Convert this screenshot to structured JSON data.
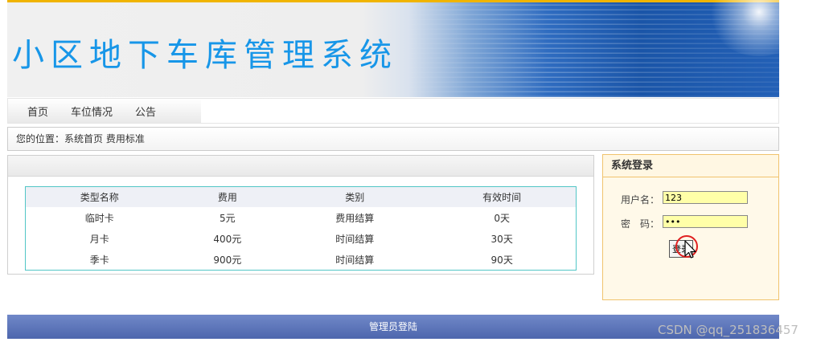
{
  "banner": {
    "title": "小区地下车库管理系统"
  },
  "nav": {
    "items": [
      "首页",
      "车位情况",
      "公告"
    ]
  },
  "breadcrumb": {
    "label": "您的位置：",
    "path": "系统首页 费用标准"
  },
  "fee_table": {
    "headers": [
      "类型名称",
      "费用",
      "类别",
      "有效时间"
    ],
    "rows": [
      [
        "临时卡",
        "5元",
        "费用结算",
        "0天"
      ],
      [
        "月卡",
        "400元",
        "时间结算",
        "30天"
      ],
      [
        "季卡",
        "900元",
        "时间结算",
        "90天"
      ]
    ]
  },
  "login": {
    "title": "系统登录",
    "username_label": "用户名：",
    "username_value": "123",
    "password_label": "密　码：",
    "password_value": "123",
    "button_label": "登录"
  },
  "footer": {
    "link_label": "管理员登陆"
  },
  "watermark": "CSDN @qq_251836457",
  "icons": {
    "cursor": "mouse-pointer-icon"
  },
  "colors": {
    "title": "#1796e8",
    "banner_stripe": "#f0b400",
    "table_border": "#52c6c6",
    "login_border": "#f0c36d",
    "footer": "#5a73b8"
  }
}
